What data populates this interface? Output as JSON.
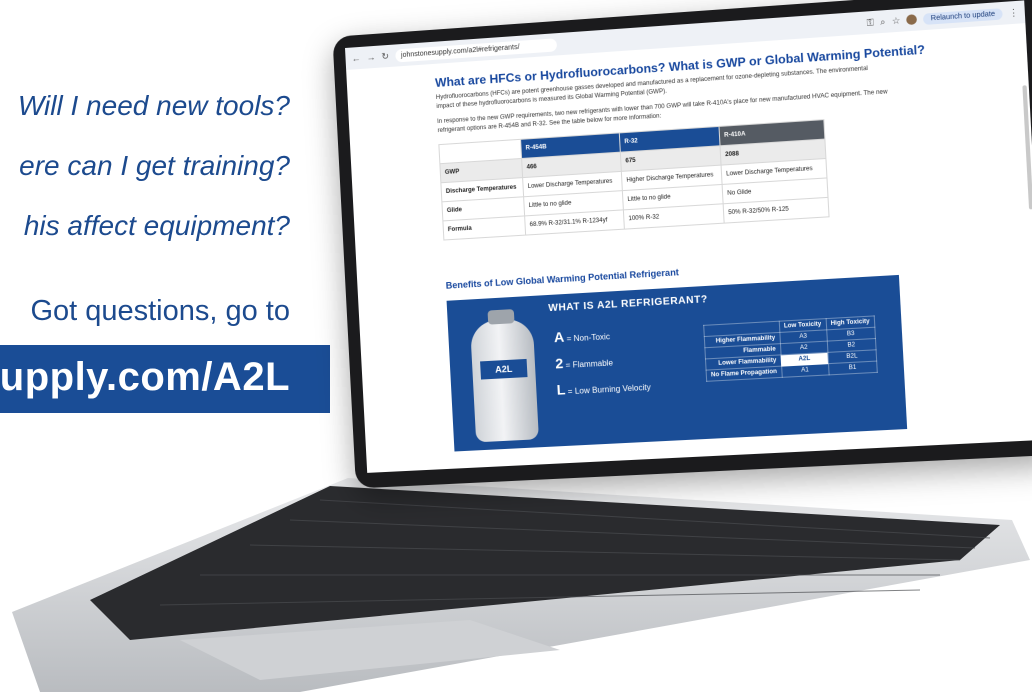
{
  "promo": {
    "question_1": "Will I need new tools?",
    "question_2": "ere can I get training?",
    "question_3": "his affect equipment?",
    "cta": "Got questions, go to",
    "url": "upply.com/A2L"
  },
  "browser": {
    "url": "johnstonesupply.com/a2l#refrigerants/",
    "relaunch_label": "Relaunch to update"
  },
  "page": {
    "heading": "What are HFCs or Hydrofluorocarbons? What is GWP or Global Warming Potential?",
    "para1": "Hydrofluorocarbons (HFCs) are potent greenhouse gasses developed and manufactured as a replacement for ozone-depleting substances. The environmental impact of these hydrofluorocarbons is measured its Global Warming Potential (GWP).",
    "para2": "In response to the new GWP requirements, two new refrigerants with lower than 700 GWP will take R-410A's place for new manufactured HVAC equipment. The new refrigerant options are R-454B and R-32. See the table below for more information:",
    "table": {
      "headers": [
        "R-454B",
        "R-32",
        "R-410A"
      ],
      "rows": [
        {
          "label": "GWP",
          "values": [
            "466",
            "675",
            "2088"
          ]
        },
        {
          "label": "Discharge Temperatures",
          "values": [
            "Lower Discharge Temperatures",
            "Higher Discharge Temperatures",
            "Lower Discharge Temperatures"
          ]
        },
        {
          "label": "Glide",
          "values": [
            "Little to no glide",
            "Little to no glide",
            "No Glide"
          ]
        },
        {
          "label": "Formula",
          "values": [
            "68.9% R-32/31.1% R-1234yf",
            "100% R-32",
            "50% R-32/50% R-125"
          ]
        }
      ]
    },
    "subheading": "Benefits of Low Global Warming Potential Refrigerant",
    "banner": {
      "title": "WHAT IS A2L REFRIGERANT?",
      "tank_label": "A2L",
      "defs": [
        {
          "letter": "A",
          "text": "= Non-Toxic"
        },
        {
          "letter": "2",
          "text": "= Flammable"
        },
        {
          "letter": "L",
          "text": "= Low Burning Velocity"
        }
      ],
      "class_table": {
        "headers": [
          "Low Toxicity",
          "High Toxicity"
        ],
        "rows": [
          {
            "label": "Higher Flammability",
            "values": [
              "A3",
              "B3"
            ]
          },
          {
            "label": "Flammable",
            "values": [
              "A2",
              "B2"
            ]
          },
          {
            "label": "Lower Flammability",
            "values": [
              "A2L",
              "B2L"
            ]
          },
          {
            "label": "No Flame Propagation",
            "values": [
              "A1",
              "B1"
            ]
          }
        ]
      }
    }
  }
}
